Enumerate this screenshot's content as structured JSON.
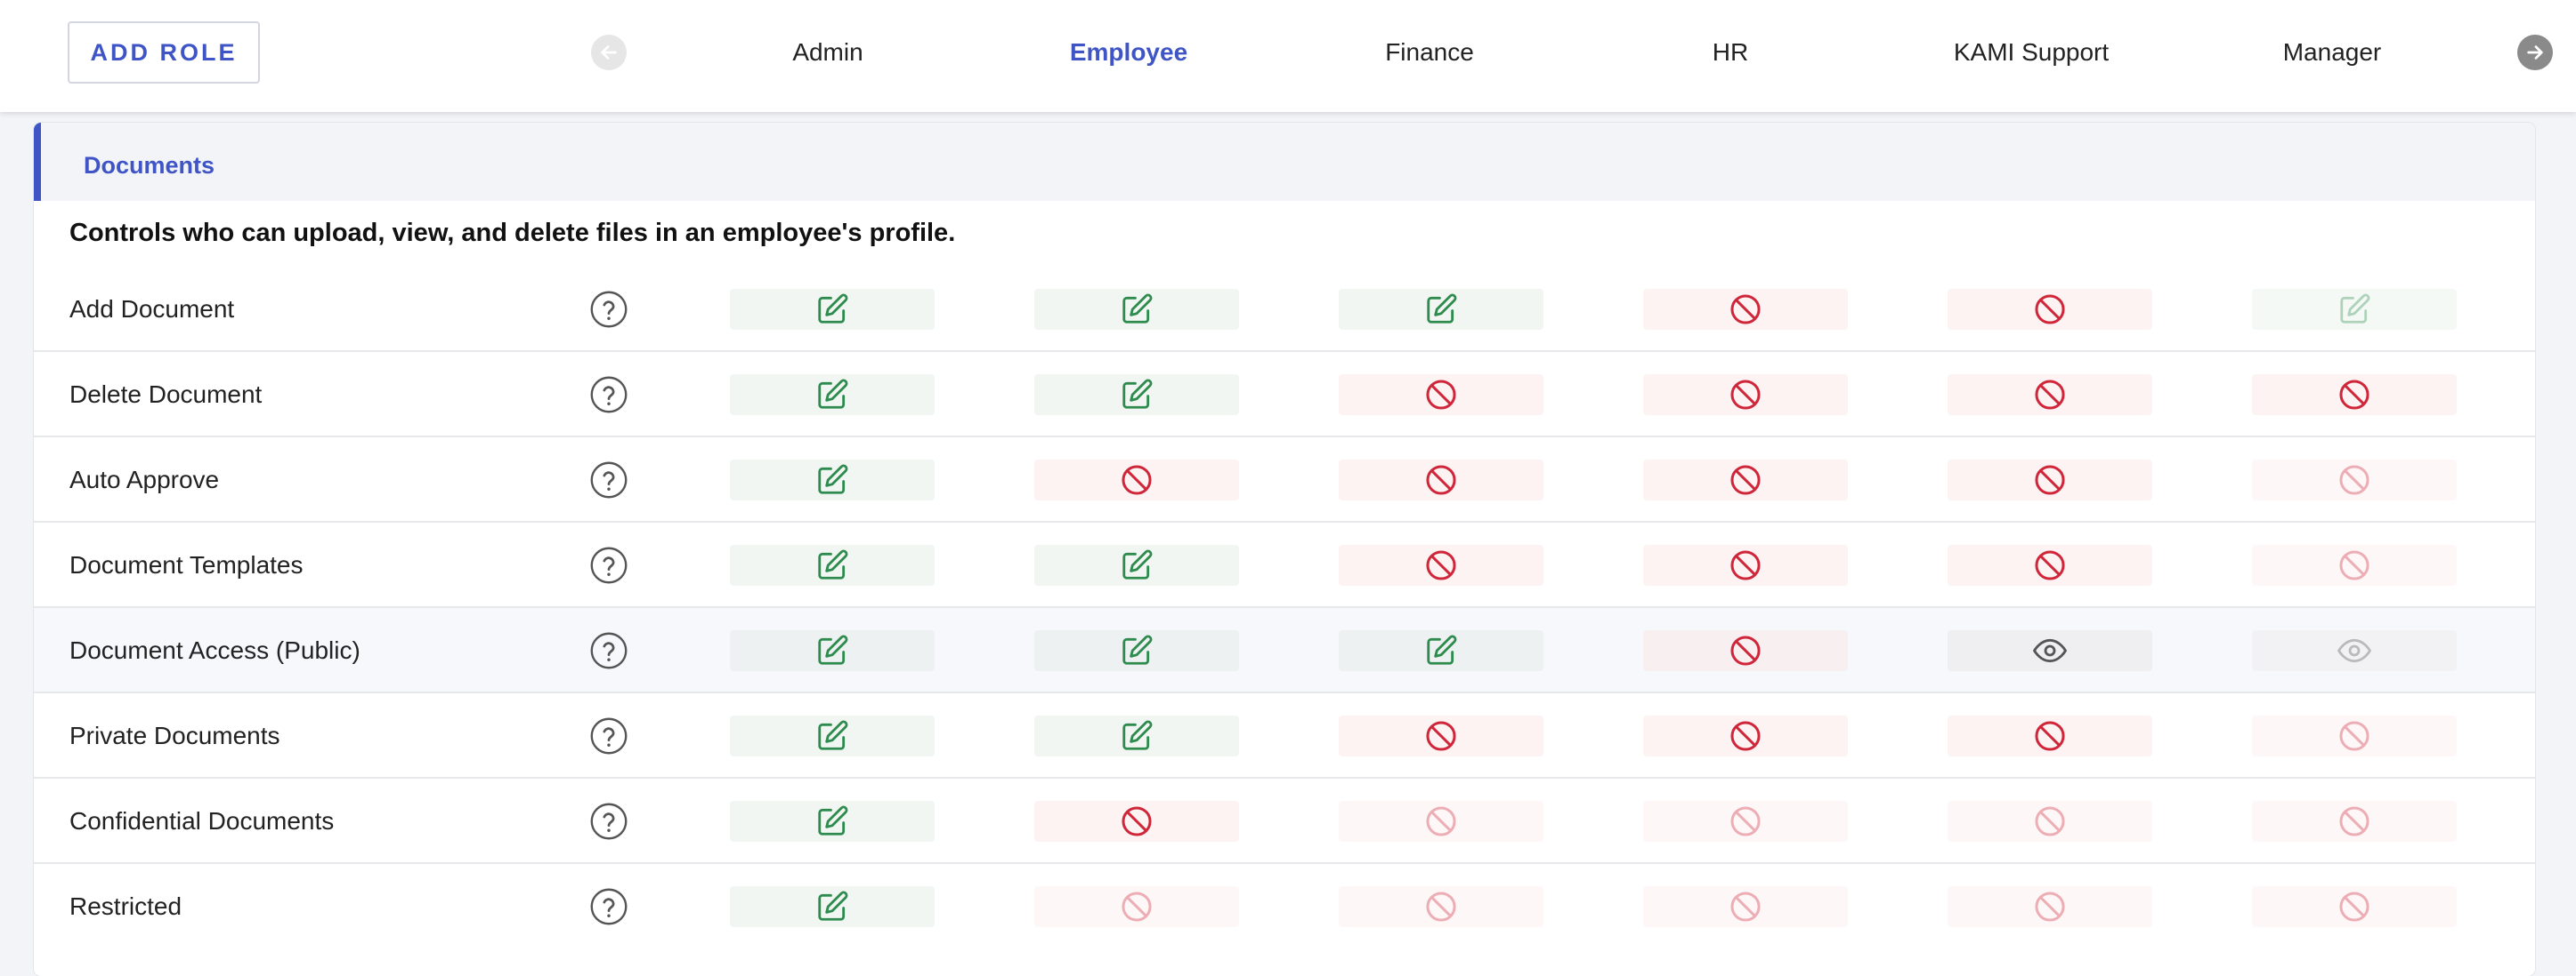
{
  "toolbar": {
    "add_role_label": "ADD ROLE"
  },
  "roles": [
    "Admin",
    "Employee",
    "Finance",
    "HR",
    "KAMI Support",
    "Manager"
  ],
  "active_role": "Employee",
  "section": {
    "title": "Documents",
    "description": "Controls who can upload, view, and delete files in an employee's profile."
  },
  "rows": [
    {
      "label": "Add Document",
      "perms": [
        "edit",
        "edit",
        "edit",
        "deny",
        "deny",
        "edit-dim"
      ]
    },
    {
      "label": "Delete Document",
      "perms": [
        "edit",
        "edit",
        "deny",
        "deny",
        "deny",
        "deny"
      ]
    },
    {
      "label": "Auto Approve",
      "perms": [
        "edit",
        "deny",
        "deny",
        "deny",
        "deny",
        "deny-dim"
      ]
    },
    {
      "label": "Document Templates",
      "perms": [
        "edit",
        "edit",
        "deny",
        "deny",
        "deny",
        "deny-dim"
      ]
    },
    {
      "label": "Document Access (Public)",
      "perms": [
        "edit",
        "edit",
        "edit",
        "deny",
        "view",
        "view-dim"
      ]
    },
    {
      "label": "Private Documents",
      "perms": [
        "edit",
        "edit",
        "deny",
        "deny",
        "deny",
        "deny-dim"
      ]
    },
    {
      "label": "Confidential Documents",
      "perms": [
        "edit",
        "deny",
        "deny-dim",
        "deny-dim",
        "deny-dim",
        "deny-dim"
      ]
    },
    {
      "label": "Restricted",
      "perms": [
        "edit",
        "deny-dim",
        "deny-dim",
        "deny-dim",
        "deny-dim",
        "deny-dim"
      ]
    }
  ],
  "icons": {
    "edit": "pencil-square-icon",
    "deny": "prohibited-icon",
    "view": "eye-icon",
    "help": "question-circle-icon",
    "prev": "arrow-left-icon",
    "next": "arrow-right-icon"
  },
  "colors": {
    "accent": "#3f55c6",
    "edit": "#2e8b4e",
    "deny": "#d0263a",
    "view": "#555555"
  }
}
